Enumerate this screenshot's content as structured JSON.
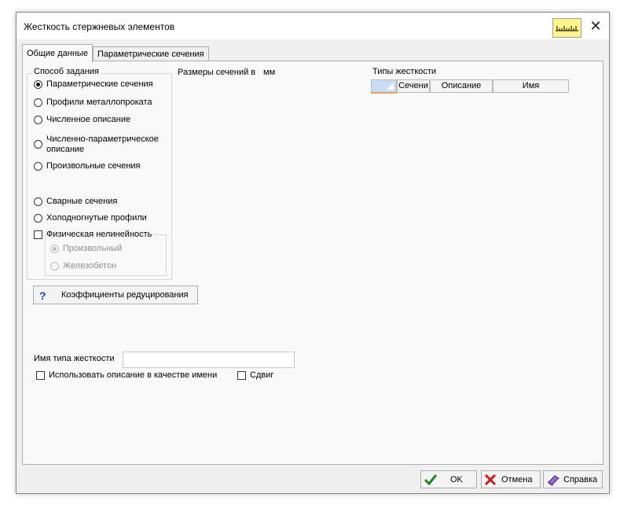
{
  "window": {
    "title": "Жесткость стержневых элементов",
    "close_glyph": "✕"
  },
  "tabs": [
    {
      "label": "Общие данные",
      "active": true
    },
    {
      "label": "Параметрические сечения",
      "active": false
    }
  ],
  "method_group": {
    "label": "Способ задания",
    "options": [
      {
        "label": "Параметрические сечения",
        "checked": true
      },
      {
        "label": "Профили металлопроката",
        "checked": false
      },
      {
        "label": "Численное описание",
        "checked": false
      },
      {
        "label": "Численно-параметрическое",
        "label2": "описание",
        "checked": false
      },
      {
        "label": "Произвольные сечения",
        "checked": false
      },
      {
        "label": "Сварные сечения",
        "checked": false
      },
      {
        "label": "Холодногнутые профили",
        "checked": false
      }
    ],
    "nonlinear": {
      "label": "Физическая нелинейность",
      "checked": false,
      "sub_options": [
        {
          "label": "Произвольный",
          "checked": true,
          "enabled": false
        },
        {
          "label": "Железобетон",
          "checked": false,
          "enabled": false
        }
      ]
    }
  },
  "section_sizes": {
    "label": "Размеры сечений в",
    "unit": "мм"
  },
  "stiffness_types": {
    "label": "Типы жесткости",
    "columns": [
      "",
      "Сечени",
      "Описание",
      "Имя"
    ]
  },
  "reduce_button": {
    "icon": "?",
    "label": "Коэффициенты редуцирования"
  },
  "stiffness_name": {
    "label": "Имя типа жесткости",
    "value": ""
  },
  "use_description": {
    "label": "Использовать описание в качестве имени",
    "checked": false
  },
  "shift": {
    "label": "Сдвиг",
    "checked": false
  },
  "footer": {
    "ok": "OK",
    "cancel": "Отмена",
    "help": "Справка"
  },
  "colors": {
    "ok_check": "#1a8a1a",
    "cancel_x": "#d01818",
    "help_book": "#7a3fb0",
    "ruler_bg": "#fff48c"
  },
  "icons": {
    "ruler": "ruler-icon",
    "ok": "check-icon",
    "cancel": "x-icon",
    "help": "book-icon"
  }
}
